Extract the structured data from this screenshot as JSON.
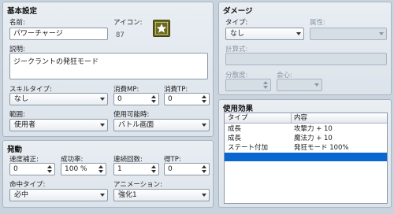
{
  "basic": {
    "title": "基本設定",
    "name_label": "名前:",
    "name_value": "パワーチャージ",
    "icon_label": "アイコン:",
    "icon_index": "87",
    "icon": "star-icon",
    "desc_label": "説明:",
    "desc_value": "ジークラントの発狂モード",
    "skill_type_label": "スキルタイプ:",
    "skill_type_value": "なし",
    "mp_label": "消費MP:",
    "mp_value": "0",
    "tp_label": "消費TP:",
    "tp_value": "0",
    "scope_label": "範囲:",
    "scope_value": "使用者",
    "occasion_label": "使用可能時:",
    "occasion_value": "バトル画面"
  },
  "invocation": {
    "title": "発動",
    "speed_label": "速度補正:",
    "speed_value": "0",
    "success_label": "成功率:",
    "success_value": "100 %",
    "repeat_label": "連続回数:",
    "repeat_value": "1",
    "tp_gain_label": "得TP:",
    "tp_gain_value": "0",
    "hit_type_label": "命中タイプ:",
    "hit_type_value": "必中",
    "animation_label": "アニメーション:",
    "animation_value": "強化1"
  },
  "damage": {
    "title": "ダメージ",
    "type_label": "タイプ:",
    "type_value": "なし",
    "element_label": "属性:",
    "element_value": "",
    "formula_label": "計算式:",
    "formula_value": "",
    "variance_label": "分散度:",
    "variance_value": "",
    "critical_label": "会心:",
    "critical_value": ""
  },
  "effects": {
    "title": "使用効果",
    "col_type": "タイプ",
    "col_content": "内容",
    "rows": [
      {
        "type": "成長",
        "content": "攻撃力 + 10"
      },
      {
        "type": "成長",
        "content": "魔法力 + 10"
      },
      {
        "type": "ステート付加",
        "content": "発狂モード 100%"
      },
      {
        "type": "",
        "content": ""
      }
    ]
  },
  "colors": {
    "background": "#c9d3dd",
    "selection": "#0b67d0",
    "icon_bg": "#6b6a1e"
  }
}
